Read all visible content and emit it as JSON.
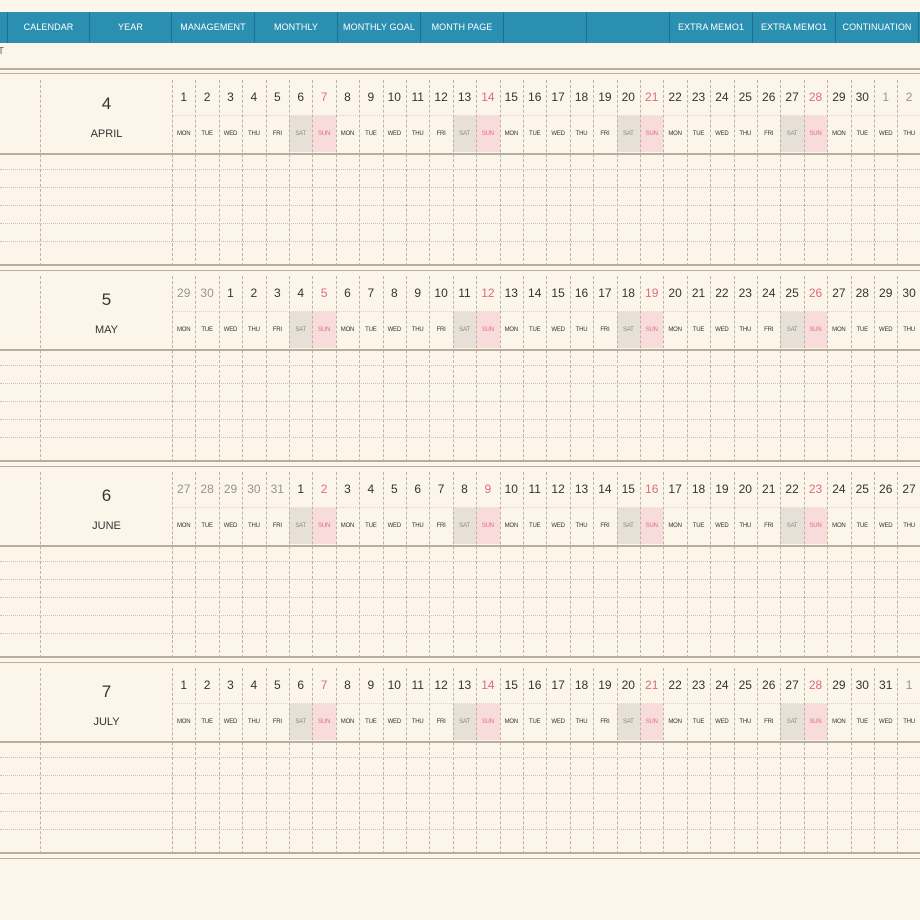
{
  "nav": {
    "tabs": [
      {
        "label": "",
        "w": 8
      },
      {
        "label": "CALENDAR",
        "w": 82
      },
      {
        "label": "YEAR",
        "w": 82
      },
      {
        "label": "MANAGEMENT",
        "w": 83
      },
      {
        "label": "MONTHLY",
        "w": 83
      },
      {
        "label": "MONTHLY GOAL",
        "w": 83
      },
      {
        "label": "MONTH PAGE",
        "w": 83
      },
      {
        "label": "",
        "w": 83
      },
      {
        "label": "",
        "w": 83
      },
      {
        "label": "EXTRA MEMO1",
        "w": 83
      },
      {
        "label": "EXTRA MEMO1",
        "w": 83
      },
      {
        "label": "CONTINUATION",
        "w": 83
      }
    ]
  },
  "below_bar_text": "T",
  "weekday_labels": [
    "MON",
    "TUE",
    "WED",
    "THU",
    "FRI",
    "SAT",
    "SUN"
  ],
  "months": [
    {
      "number": "4",
      "name": "APRIL",
      "days": [
        1,
        2,
        3,
        4,
        5,
        6,
        7,
        8,
        9,
        10,
        11,
        12,
        13,
        14,
        15,
        16,
        17,
        18,
        19,
        20,
        21,
        22,
        23,
        24,
        25,
        26,
        27,
        28,
        29,
        30,
        1,
        2
      ],
      "prev_count": 0,
      "next_from": 30
    },
    {
      "number": "5",
      "name": "MAY",
      "days": [
        29,
        30,
        1,
        2,
        3,
        4,
        5,
        6,
        7,
        8,
        9,
        10,
        11,
        12,
        13,
        14,
        15,
        16,
        17,
        18,
        19,
        20,
        21,
        22,
        23,
        24,
        25,
        26,
        27,
        28,
        29,
        30
      ],
      "prev_count": 2,
      "next_from": 32
    },
    {
      "number": "6",
      "name": "JUNE",
      "days": [
        27,
        28,
        29,
        30,
        31,
        1,
        2,
        3,
        4,
        5,
        6,
        7,
        8,
        9,
        10,
        11,
        12,
        13,
        14,
        15,
        16,
        17,
        18,
        19,
        20,
        21,
        22,
        23,
        24,
        25,
        26,
        27
      ],
      "prev_count": 5,
      "next_from": 32
    },
    {
      "number": "7",
      "name": "JULY",
      "days": [
        1,
        2,
        3,
        4,
        5,
        6,
        7,
        8,
        9,
        10,
        11,
        12,
        13,
        14,
        15,
        16,
        17,
        18,
        19,
        20,
        21,
        22,
        23,
        24,
        25,
        26,
        27,
        28,
        29,
        30,
        31,
        1
      ],
      "prev_count": 0,
      "next_from": 31
    }
  ]
}
